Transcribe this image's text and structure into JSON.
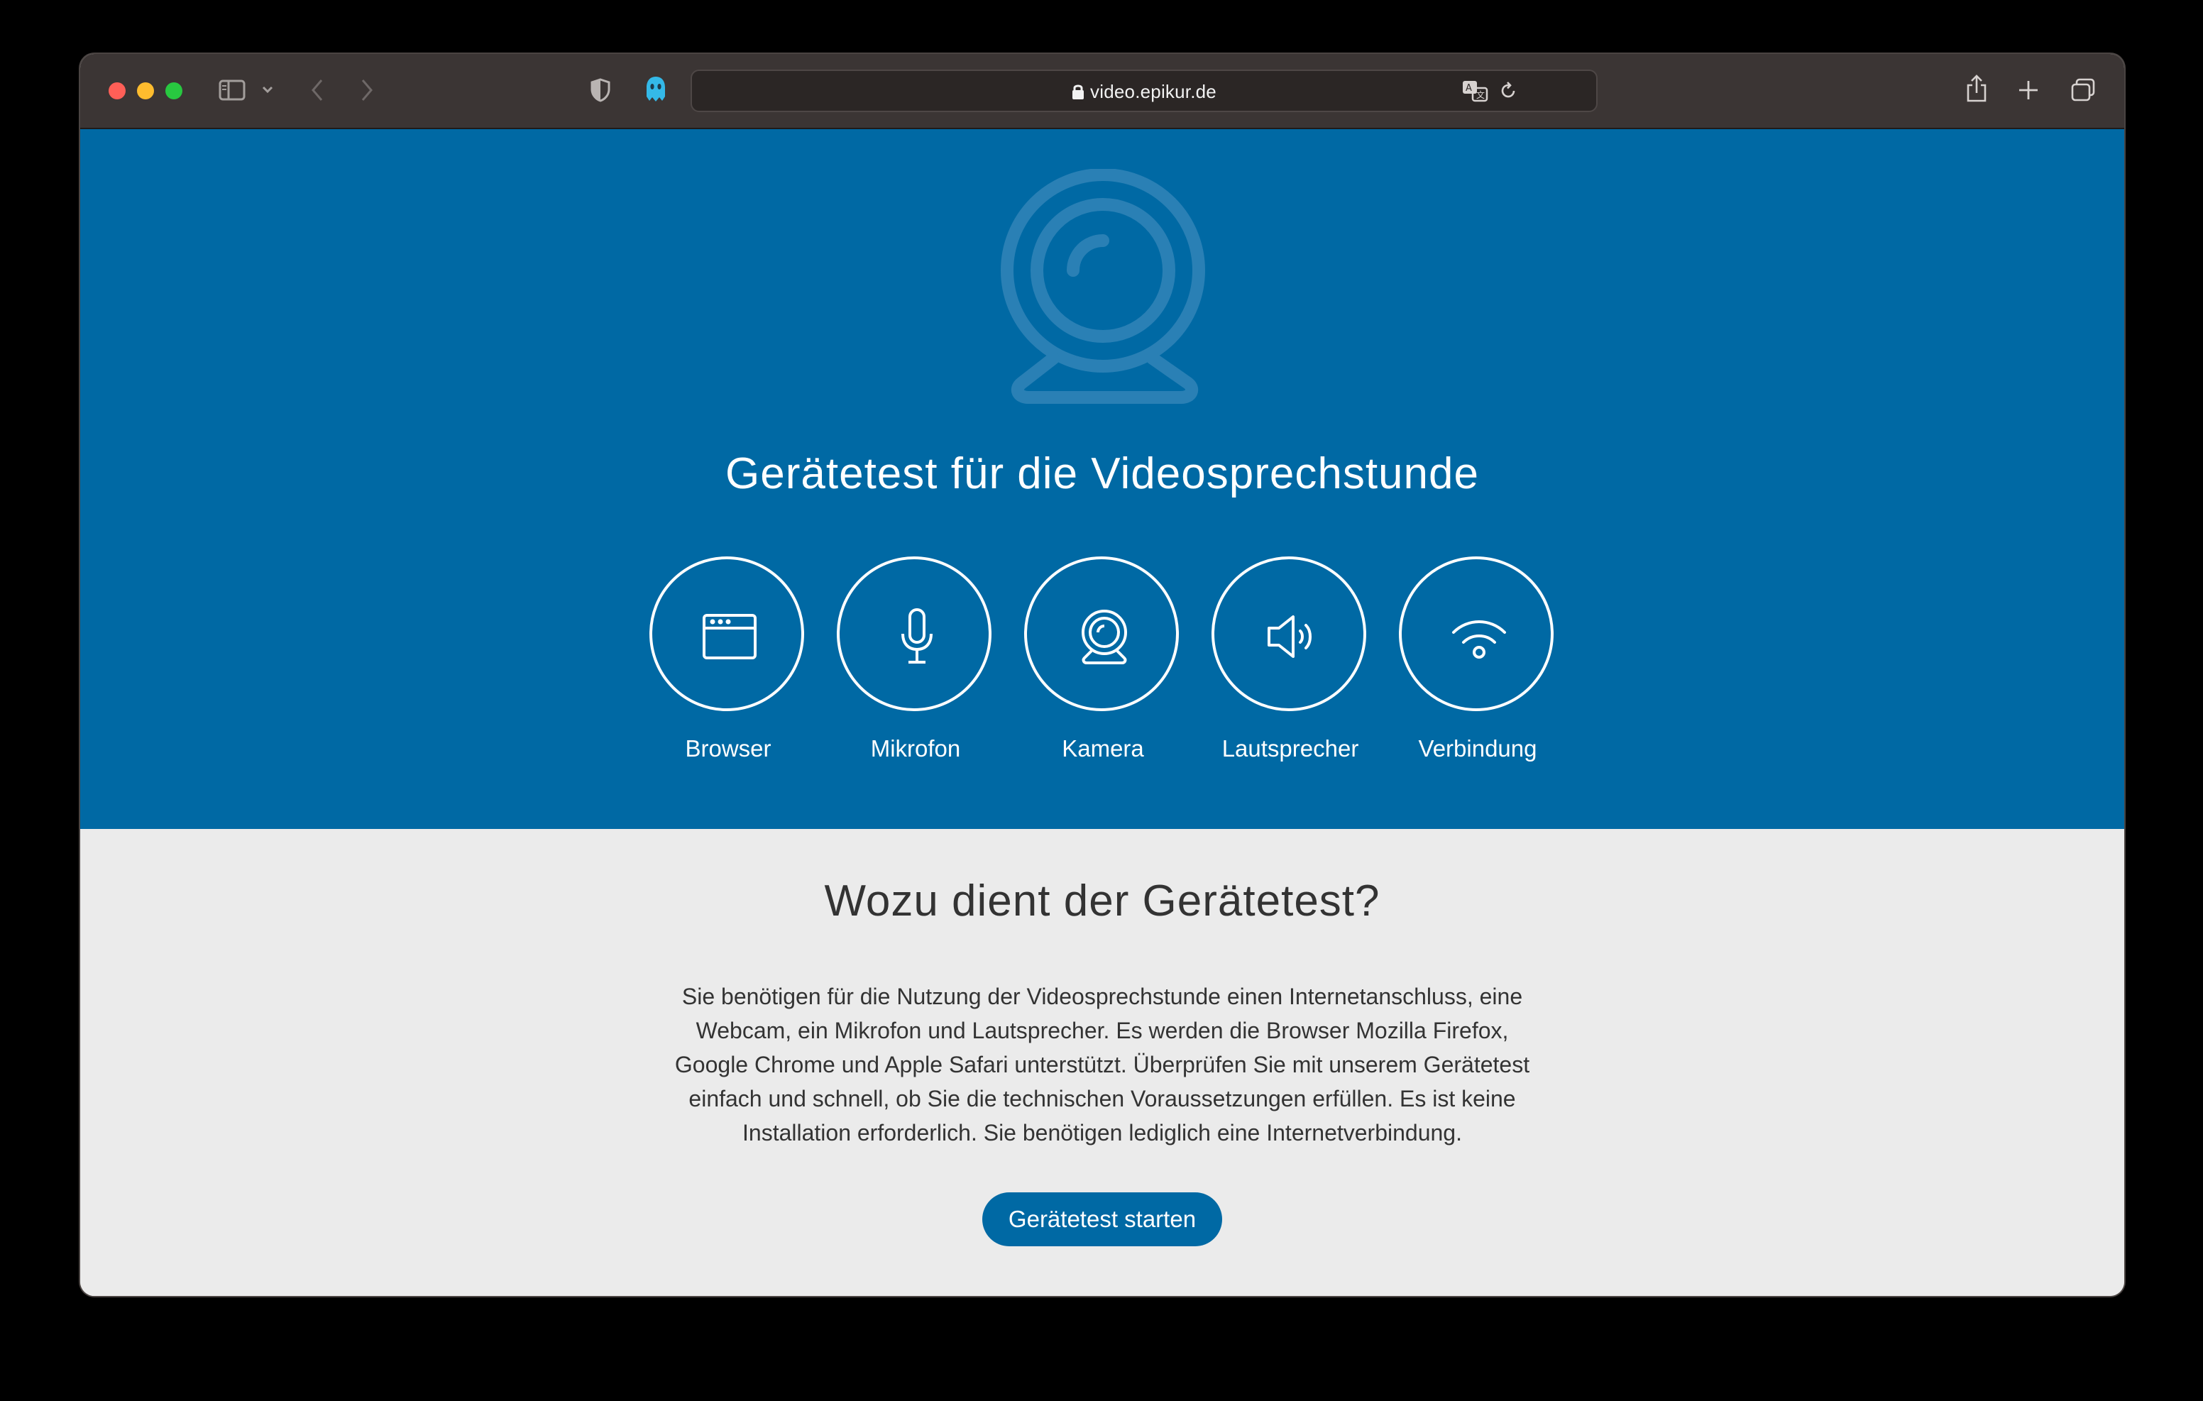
{
  "browser": {
    "url": "video.epikur.de",
    "icons": [
      "sidebar-icon",
      "chevron-down-icon",
      "back-icon",
      "forward-icon",
      "shield-icon",
      "ghostery-icon",
      "lock-icon",
      "translate-icon",
      "reload-icon",
      "share-icon",
      "new-tab-icon",
      "tab-overview-icon"
    ]
  },
  "hero": {
    "title": "Gerätetest für die Videosprechstunde",
    "features": [
      {
        "label": "Browser",
        "icon": "browser-window-icon"
      },
      {
        "label": "Mikrofon",
        "icon": "microphone-icon"
      },
      {
        "label": "Kamera",
        "icon": "webcam-icon"
      },
      {
        "label": "Lautsprecher",
        "icon": "speaker-icon"
      },
      {
        "label": "Verbindung",
        "icon": "wifi-icon"
      }
    ]
  },
  "info": {
    "title": "Wozu dient der Gerätetest?",
    "lines": [
      "Sie benötigen für die Nutzung der Videosprechstunde einen Internetanschluss, eine",
      "Webcam, ein Mikrofon und Lautsprecher. Es werden die Browser Mozilla Firefox,",
      "Google Chrome und Apple Safari unterstützt. Überprüfen Sie mit unserem Gerätetest",
      "einfach und schnell, ob Sie die technischen Voraussetzungen erfüllen. Es ist keine",
      "Installation erforderlich. Sie benötigen lediglich eine Internetverbindung."
    ],
    "start_button": "Gerätetest starten"
  },
  "colors": {
    "primary": "#0069a4",
    "background": "#ebebeb",
    "toolbar": "#3b3534",
    "text": "#333333"
  }
}
